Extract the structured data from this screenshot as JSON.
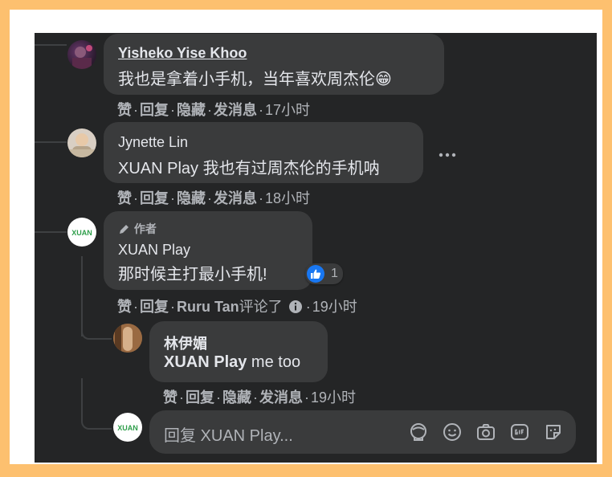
{
  "comments": [
    {
      "author": "Yisheko Yise Khoo",
      "text": "我也是拿着小手机，当年喜欢周杰伦😁",
      "actions": {
        "like": "赞",
        "reply": "回复",
        "hide": "隐藏",
        "message": "发消息"
      },
      "time": "17小时"
    },
    {
      "author": "Jynette Lin",
      "text": "XUAN Play 我也有过周杰伦的手机呐",
      "actions": {
        "like": "赞",
        "reply": "回复",
        "hide": "隐藏",
        "message": "发消息"
      },
      "time": "18小时"
    },
    {
      "author_badge": "作者",
      "author": "XUAN Play",
      "text": "那时候主打最小手机!",
      "reaction_count": "1",
      "actions": {
        "like": "赞",
        "reply": "回复"
      },
      "commenter_name": "Ruru Tan",
      "commenter_suffix": "评论了",
      "time": "19小时"
    }
  ],
  "reply": {
    "author": "林伊媚",
    "text_mention": "XUAN Play",
    "text_rest": " me too",
    "actions": {
      "like": "赞",
      "reply": "回复",
      "hide": "隐藏",
      "message": "发消息"
    },
    "time": "19小时"
  },
  "reply_input": {
    "placeholder": "回复 XUAN Play..."
  },
  "separator": "·",
  "more_icon": "more-horizontal-icon",
  "avatar_brand": "XUAN",
  "colors": {
    "panel_bg": "#242526",
    "bubble_bg": "#3a3b3c",
    "text": "#e4e6eb",
    "secondary_text": "#b0b3b8",
    "like_blue": "#1877f2",
    "outer_bg": "#fdc06f"
  }
}
